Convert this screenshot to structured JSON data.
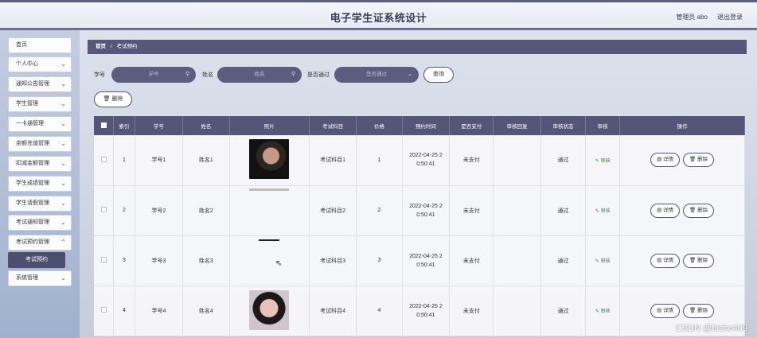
{
  "header": {
    "title": "电子学生证系统设计",
    "admin": "管理员 abo",
    "logout": "退出登录"
  },
  "sidebar": {
    "items": [
      {
        "label": "首页",
        "chevron": false
      },
      {
        "label": "个人中心",
        "chevron": true
      },
      {
        "label": "通知公告管理",
        "chevron": true
      },
      {
        "label": "学生管理",
        "chevron": true
      },
      {
        "label": "一卡通管理",
        "chevron": true
      },
      {
        "label": "余额充值管理",
        "chevron": true
      },
      {
        "label": "扣减金额管理",
        "chevron": true
      },
      {
        "label": "学生成绩管理",
        "chevron": true
      },
      {
        "label": "学生请假管理",
        "chevron": true
      },
      {
        "label": "考试通知管理",
        "chevron": true
      },
      {
        "label": "考试预约管理",
        "chevron": true
      }
    ],
    "subitem": "考试预约",
    "last_item": "系统管理"
  },
  "breadcrumb": {
    "home": "首页",
    "sep": "/",
    "current": "考试预约"
  },
  "search": {
    "student_id_label": "学号",
    "student_id_placeholder": "学号",
    "name_label": "姓名",
    "name_placeholder": "姓名",
    "passed_label": "是否通过",
    "passed_placeholder": "是否通过",
    "query_button": "查询"
  },
  "delete_button": "删除",
  "table": {
    "headers": [
      "索引",
      "学号",
      "姓名",
      "照片",
      "考试科目",
      "价格",
      "预约时间",
      "是否支付",
      "审核回复",
      "审核状态",
      "审核",
      "操作"
    ],
    "rows": [
      {
        "index": "1",
        "student_id": "学号1",
        "name": "姓名1",
        "subject": "考试科目1",
        "price": "1",
        "time_a": "2022-04-25 2",
        "time_b": "0:50:41",
        "paid": "未支付",
        "reply": "",
        "status": "通过",
        "audit": "审核"
      },
      {
        "index": "2",
        "student_id": "学号2",
        "name": "姓名2",
        "subject": "考试科目2",
        "price": "2",
        "time_a": "2022-04-25 2",
        "time_b": "0:50:41",
        "paid": "未支付",
        "reply": "",
        "status": "通过",
        "audit": "审核"
      },
      {
        "index": "3",
        "student_id": "学号3",
        "name": "姓名3",
        "subject": "考试科目3",
        "price": "3",
        "time_a": "2022-04-25 2",
        "time_b": "0:50:41",
        "paid": "未支付",
        "reply": "",
        "status": "通过",
        "audit": "审核"
      },
      {
        "index": "4",
        "student_id": "学号4",
        "name": "姓名4",
        "subject": "考试科目4",
        "price": "4",
        "time_a": "2022-04-25 2",
        "time_b": "0:50:41",
        "paid": "未支付",
        "reply": "",
        "status": "通过",
        "audit": "审核"
      }
    ],
    "detail_button": "详情",
    "row_delete_button": "删除"
  },
  "watermark": "CSDN @bishe409",
  "colors": {
    "accent": "#545678",
    "audit": "#2e8b3e"
  }
}
